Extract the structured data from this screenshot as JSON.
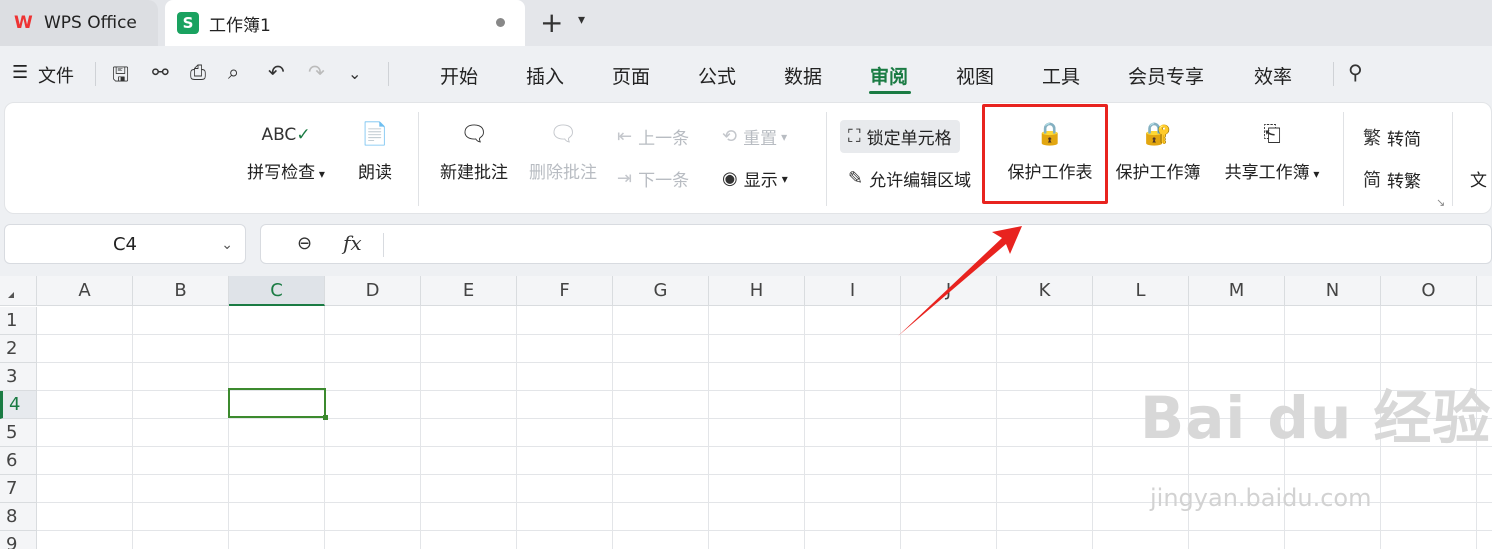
{
  "tabs": {
    "app_label": "WPS Office",
    "doc_label": "工作簿1",
    "doc_icon_letter": "S",
    "add_label": "+",
    "more_label": "⌄"
  },
  "menu": {
    "file_label": "文件",
    "items": [
      "开始",
      "插入",
      "页面",
      "公式",
      "数据",
      "审阅",
      "视图",
      "工具",
      "会员专享",
      "效率"
    ],
    "active": "审阅"
  },
  "ribbon": {
    "spell_icon_text": "ABC",
    "spell_check": "拼写检查",
    "read_aloud": "朗读",
    "new_comment": "新建批注",
    "delete_comment": "删除批注",
    "prev": "上一条",
    "next": "下一条",
    "reset": "重置",
    "show": "显示",
    "lock_cell": "锁定单元格",
    "allow_edit_range": "允许编辑区域",
    "protect_sheet": "保护工作表",
    "protect_workbook": "保护工作簿",
    "share_workbook": "共享工作簿",
    "to_simplified": "转简",
    "to_traditional": "转繁",
    "trad_icon": "繁",
    "simp_icon": "简",
    "doc_cut": "文"
  },
  "formula_bar": {
    "cell_ref": "C4",
    "fx_label": "fx",
    "formula": ""
  },
  "grid": {
    "columns": [
      "A",
      "B",
      "C",
      "D",
      "E",
      "F",
      "G",
      "H",
      "I",
      "J",
      "K",
      "L",
      "M",
      "N",
      "O"
    ],
    "rows": [
      "1",
      "2",
      "3",
      "4",
      "5",
      "6",
      "7",
      "8",
      "9"
    ],
    "selected_cell": "C4",
    "selected_column": "C",
    "selected_row": "4"
  },
  "watermark": {
    "line1": "Bai du 经验",
    "line2": "jingyan.baidu.com"
  },
  "colors": {
    "accent": "#1a7b43",
    "highlight": "#e8231f"
  }
}
